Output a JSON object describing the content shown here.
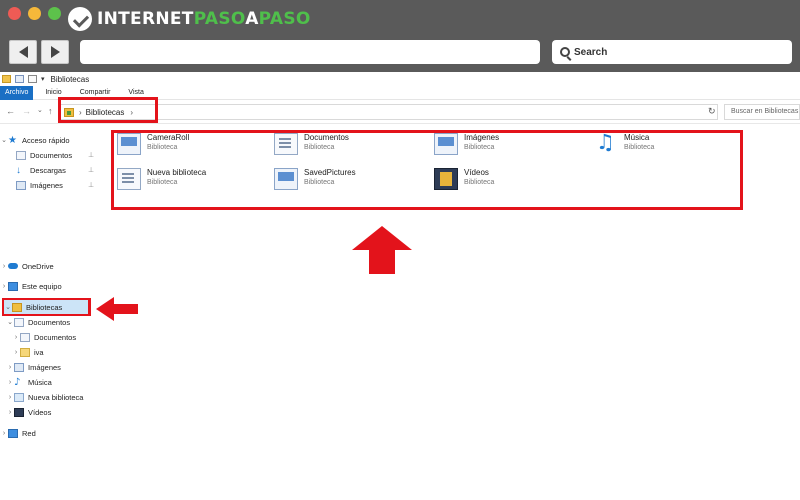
{
  "brand": {
    "part1": "INTERNET",
    "part2": "PASO",
    "part3": "A",
    "part4": "PASO"
  },
  "browser": {
    "search_label": "Search"
  },
  "explorer": {
    "window_title": "Bibliotecas",
    "ribbon_tabs": [
      "Archivo",
      "Inicio",
      "Compartir",
      "Vista"
    ],
    "breadcrumb": "Bibliotecas",
    "search_placeholder": "Buscar en Bibliotecas"
  },
  "nav": {
    "quick_access": "Acceso rápido",
    "quick_items": [
      "Documentos",
      "Descargas",
      "Imágenes"
    ],
    "onedrive": "OneDrive",
    "this_pc": "Este equipo",
    "libraries": "Bibliotecas",
    "library_children": [
      "Documentos",
      "Documentos",
      "iva",
      "Imágenes",
      "Música",
      "Nueva biblioteca",
      "Vídeos"
    ],
    "network": "Red"
  },
  "libraries": [
    {
      "name": "CameraRoll",
      "type": "Biblioteca",
      "icon": "camera-roll-icon"
    },
    {
      "name": "Documentos",
      "type": "Biblioteca",
      "icon": "documents-icon"
    },
    {
      "name": "Imágenes",
      "type": "Biblioteca",
      "icon": "pictures-icon"
    },
    {
      "name": "Música",
      "type": "Biblioteca",
      "icon": "music-icon"
    },
    {
      "name": "Nueva biblioteca",
      "type": "Biblioteca",
      "icon": "new-library-icon"
    },
    {
      "name": "SavedPictures",
      "type": "Biblioteca",
      "icon": "saved-pictures-icon"
    },
    {
      "name": "Vídeos",
      "type": "Biblioteca",
      "icon": "videos-icon"
    }
  ],
  "colors": {
    "highlight": "#e3131b",
    "brand_accent": "#4fbf4b",
    "selection": "#cce4f7"
  }
}
